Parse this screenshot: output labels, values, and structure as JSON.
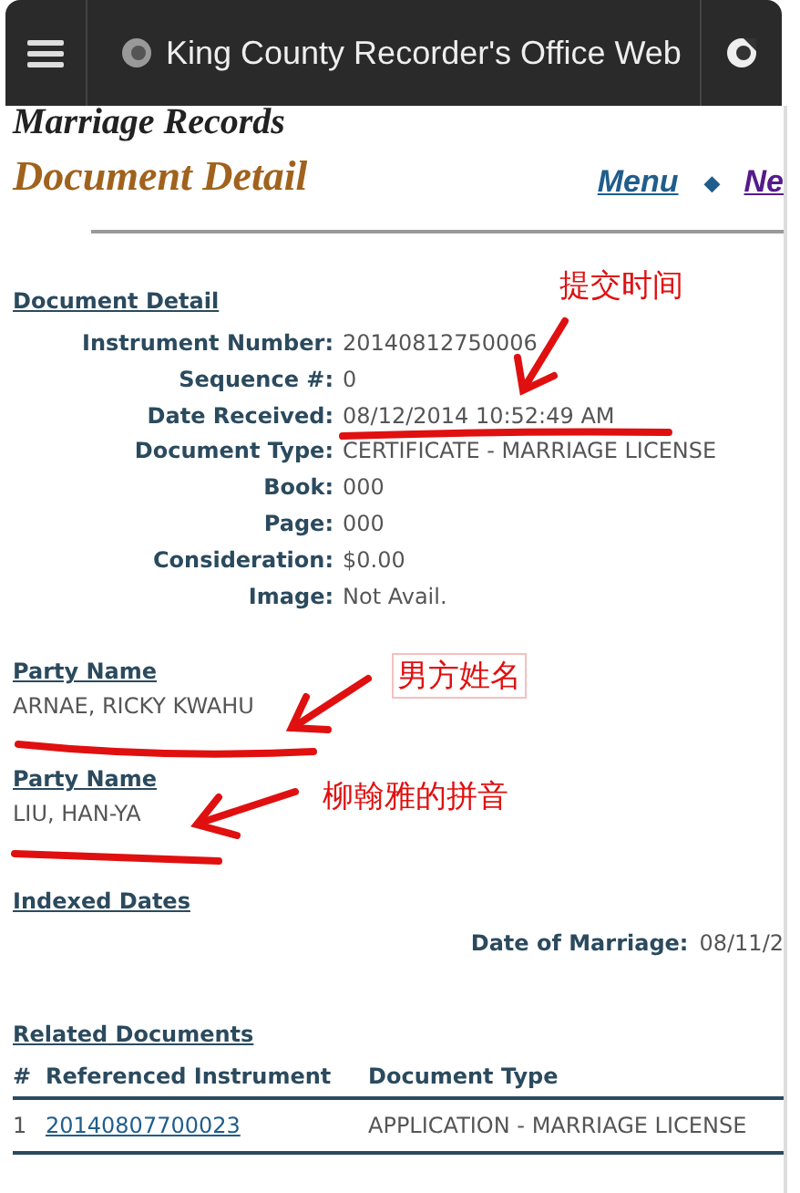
{
  "browser_bar": {
    "title": "King County Recorder's Office Web"
  },
  "page": {
    "heading": "Marriage Records",
    "subheading": "Document Detail",
    "nav": [
      {
        "label": "Menu",
        "kind": "link"
      },
      {
        "label": "◆",
        "kind": "separator"
      },
      {
        "label": "Ne",
        "kind": "visited"
      }
    ]
  },
  "document_detail": {
    "title": "Document Detail",
    "fields": [
      {
        "label": "Instrument Number:",
        "value": "20140812750006"
      },
      {
        "label": "Sequence #:",
        "value": "0"
      },
      {
        "label": "Date Received:",
        "value": "08/12/2014 10:52:49 AM"
      },
      {
        "label": "Document Type:",
        "value": "CERTIFICATE - MARRIAGE LICENSE"
      },
      {
        "label": "Book:",
        "value": "000"
      },
      {
        "label": "Page:",
        "value": "000"
      },
      {
        "label": "Consideration:",
        "value": "$0.00"
      },
      {
        "label": "Image:",
        "value": "Not Avail."
      }
    ]
  },
  "parties": [
    {
      "title": "Party Name",
      "name": "ARNAE, RICKY KWAHU"
    },
    {
      "title": "Party Name",
      "name": "LIU, HAN-YA"
    }
  ],
  "indexed_dates": {
    "title": "Indexed Dates",
    "label": "Date of Marriage:",
    "value": "08/11/2"
  },
  "related_documents": {
    "title": "Related Documents",
    "columns": [
      "#",
      "Referenced Instrument",
      "Document Type"
    ],
    "rows": [
      {
        "number": "1",
        "instrument": "20140807700023",
        "type": "APPLICATION - MARRIAGE LICENSE"
      }
    ]
  },
  "annotations": [
    "提交时间",
    "男方姓名",
    "柳翰雅的拼音"
  ]
}
